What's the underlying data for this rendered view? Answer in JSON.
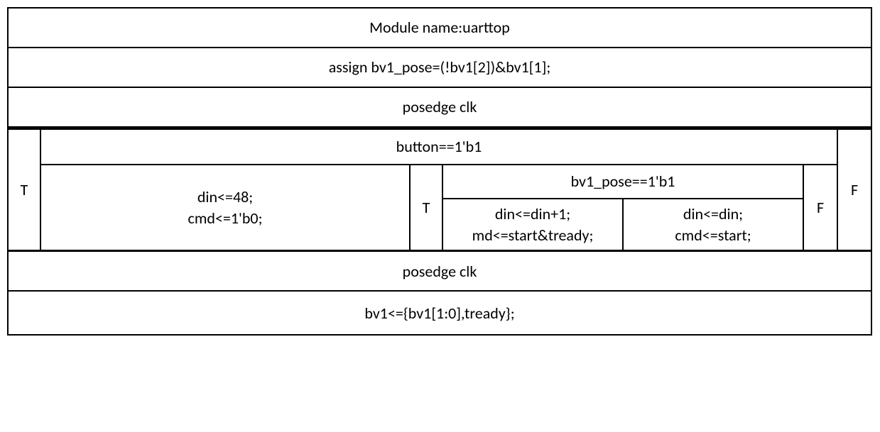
{
  "header": {
    "module_name": "Module name:uarttop",
    "assign_stmt": "assign bv1_pose=(!bv1[2])&bv1[1];",
    "trigger": "posedge clk"
  },
  "cond1": {
    "label_T": "T",
    "label_F": "F",
    "expr": "button==1'b1",
    "true_block": {
      "line1": "din<=48;",
      "line2": "cmd<=1'b0;"
    },
    "false_block": {
      "label_T": "T",
      "label_F": "F",
      "expr": "bv1_pose==1'b1",
      "true_block": {
        "line1": "din<=din+1;",
        "line2": "md<=start&tready;"
      },
      "false_block": {
        "line1": "din<=din;",
        "line2": "cmd<=start;"
      }
    }
  },
  "footer": {
    "trigger": "posedge clk",
    "stmt": "bv1<={bv1[1:0],tready};"
  }
}
